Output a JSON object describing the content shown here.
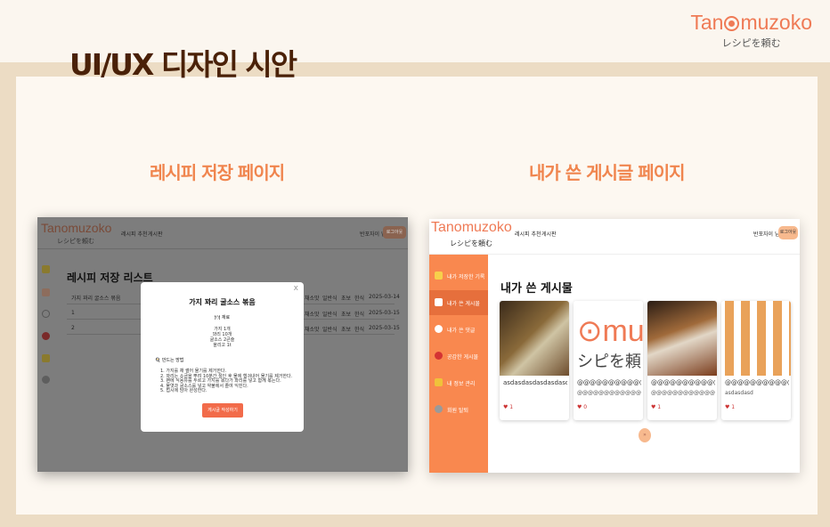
{
  "page": {
    "title": "UI/UX 디자인 시안",
    "brand": {
      "name": "Tanomuzoko",
      "subtitle": "レシピを頼む"
    }
  },
  "left": {
    "section_title": "레시피 저장 페이지",
    "logo": "Tanomuzoko",
    "logo_sub": "レシピを頼む",
    "nav": [
      "레시피 추천",
      "게시판"
    ],
    "user": "반포자이 님",
    "logout": "로그아웃",
    "heading": "레시피 저장 리스트",
    "table": {
      "header_title": "가지 꽈리 굴소스 볶음",
      "cols": [
        "채소맛",
        "일반식",
        "초보",
        "한식",
        "2025-03-14"
      ],
      "rows": [
        {
          "num": "1",
          "cols": [
            "채소맛",
            "일반식",
            "초보",
            "한식",
            "2025-03-15"
          ]
        },
        {
          "num": "2",
          "cols": [
            "채소맛",
            "일반식",
            "초보",
            "한식",
            "2025-03-15"
          ]
        }
      ]
    },
    "modal": {
      "close": "x",
      "title": "가지 꽈리 굴소스 볶음",
      "ingredients_label": "🍽 재료",
      "ingredients": [
        "가지 1개",
        "꽈리 10개",
        "굴소스 2큰술",
        "올리고 1t"
      ],
      "method_label": "🍳 만드는 방법",
      "steps": [
        "1.   가지를 채 썰어 물기를 제거한다.",
        "2.   꽈리는 소금을 뿌려 10분간 절인 후 물에 헹궈내어 물기를 제거한다.",
        "3.   팬에 식용유를 두르고 가지를 볶다가 꽈리를 넣고 함께 볶는다.",
        "4.   물엿과 굴소스를 넣고 약불에서 졸여 익힌다.",
        "5.   접시에 담아 완성한다."
      ],
      "button": "게시글 작성하기"
    }
  },
  "right": {
    "section_title": "내가 쓴 게시글 페이지",
    "logo": "Tanomuzoko",
    "logo_sub": "レシピを頼む",
    "nav": [
      "레시피 추천",
      "게시판"
    ],
    "user": "반포자이 님",
    "logout": "로그아웃",
    "sidebar": [
      {
        "label": "내가 저장한 기록",
        "icon": "folder-icon",
        "color": "#f7d04b"
      },
      {
        "label": "내가 쓴 게시물",
        "icon": "pencil-icon",
        "color": "#ffffff"
      },
      {
        "label": "내가 쓴 댓글",
        "icon": "circle-icon",
        "color": "#ffffff"
      },
      {
        "label": "공감한 게시물",
        "icon": "heart-icon",
        "color": "#d43333"
      },
      {
        "label": "내 정보 관리",
        "icon": "key-icon",
        "color": "#f0c23a"
      },
      {
        "label": "회원 탈퇴",
        "icon": "gear-icon",
        "color": "#9a9a9a"
      }
    ],
    "heading": "내가 쓴 게시물",
    "cards": [
      {
        "title": "asdasdasdasdasdasd",
        "desc": "",
        "likes": "1"
      },
      {
        "title": "@@@@@@@@@@@@@@@@",
        "desc": "@@@@@@@@@@@@@@@@@@",
        "likes": "0"
      },
      {
        "title": "@@@@@@@@@@@@@@@@",
        "desc": "@@@@@@@@@@@@@@@@@@",
        "likes": "1"
      },
      {
        "title": "@@@@@@@@@@@@@@@@",
        "desc": "asdasdasd",
        "likes": "1"
      }
    ],
    "more": "»"
  }
}
